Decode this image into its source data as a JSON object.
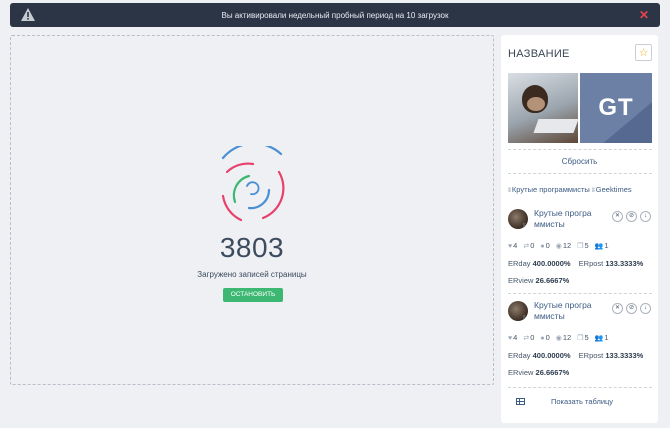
{
  "banner": {
    "message": "Вы активировали недельный пробный период на 10 загрузок",
    "close_glyph": "✕",
    "warning_icon": "warning-triangle-icon"
  },
  "loader": {
    "count": "3803",
    "label": "Загружено записей страницы",
    "stop_label": "ОСТАНОВИТЬ",
    "ring_colors": [
      "#4a8fd6",
      "#e8406a",
      "#3cb872"
    ]
  },
  "panel": {
    "title": "НАЗВАНИЕ",
    "star_glyph": "☆",
    "reset_label": "Сбросить",
    "groups": [
      {
        "icon": "vk-icon",
        "label": "Крутые программисты"
      },
      {
        "icon": "vk-icon",
        "label": "Geektimes"
      }
    ],
    "avatar_gt_text": "GT",
    "cards": [
      {
        "name_line1": "Крутые програ",
        "name_line2": "ммисты",
        "actions": [
          "✕",
          "⊘",
          "↓"
        ],
        "likes": "4",
        "reposts": "0",
        "comments": "0",
        "views": "12",
        "copies": "5",
        "users": "1",
        "er_day_label": "ERday",
        "er_day": "400.0000%",
        "er_post_label": "ERpost",
        "er_post": "133.3333%",
        "er_view_label": "ERview",
        "er_view": "26.6667%"
      },
      {
        "name_line1": "Крутые програ",
        "name_line2": "ммисты",
        "actions": [
          "✕",
          "⊘",
          "↓"
        ],
        "likes": "4",
        "reposts": "0",
        "comments": "0",
        "views": "12",
        "copies": "5",
        "users": "1",
        "er_day_label": "ERday",
        "er_day": "400.0000%",
        "er_post_label": "ERpost",
        "er_post": "133.3333%",
        "er_view_label": "ERview",
        "er_view": "26.6667%"
      }
    ],
    "show_table_label": "Показать таблицу"
  },
  "colors": {
    "banner_bg": "#2c3545",
    "accent_green": "#3cb872",
    "link_blue": "#3d5c84",
    "close_red": "#e8424f"
  }
}
